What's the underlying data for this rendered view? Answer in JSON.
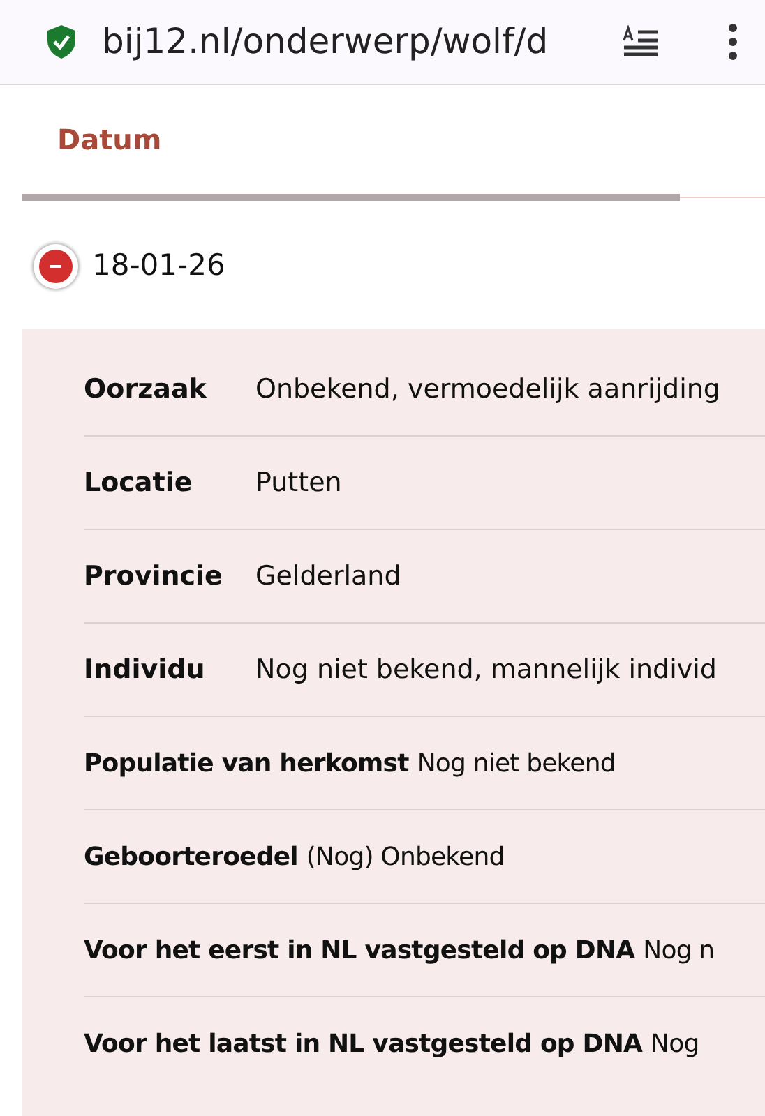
{
  "browser_bar": {
    "url": "bij12.nl/onderwerp/wolf/d"
  },
  "table_header": {
    "column_1": "Datum"
  },
  "entry": {
    "date": "18-01-26",
    "expanded": true,
    "rows": [
      {
        "kind": "column",
        "label": "Oorzaak",
        "value": "Onbekend, vermoedelijk aanrijding"
      },
      {
        "kind": "column",
        "label": "Locatie",
        "value": "Putten"
      },
      {
        "kind": "column",
        "label": "Provincie",
        "value": "Gelderland"
      },
      {
        "kind": "column",
        "label": "Individu",
        "value": "Nog niet bekend, mannelijk individ"
      },
      {
        "kind": "inline",
        "label": "Populatie van herkomst",
        "value": "Nog niet bekend"
      },
      {
        "kind": "inline",
        "label": "Geboorteroedel",
        "value": "(Nog) Onbekend"
      },
      {
        "kind": "inline",
        "label": "Voor het eerst in NL vastgesteld op DNA",
        "value": "Nog n"
      },
      {
        "kind": "inline",
        "label": "Voor het laatst in NL vastgesteld op DNA",
        "value": "Nog"
      }
    ]
  }
}
